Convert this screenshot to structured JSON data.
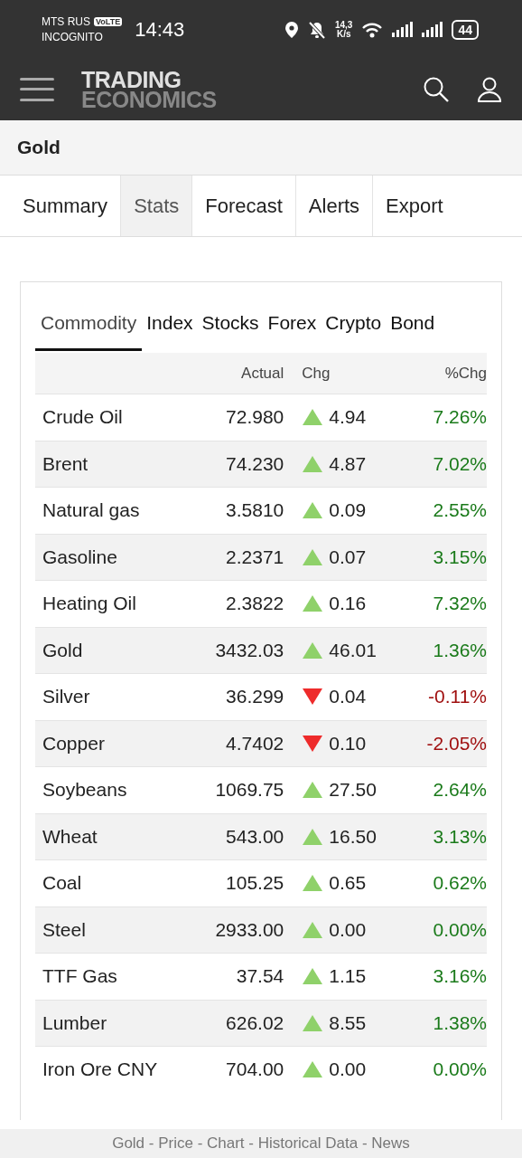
{
  "status_bar": {
    "carrier": "MTS RUS",
    "volte": "VoLTE",
    "mode": "INCOGNITO",
    "time": "14:43",
    "speed_value": "14,3",
    "speed_unit": "K/s",
    "battery": "44"
  },
  "header": {
    "logo_top": "TRADING",
    "logo_bottom": "ECONOMICS"
  },
  "page_title": "Gold",
  "tabs": [
    {
      "label": "Summary",
      "selected": false
    },
    {
      "label": "Stats",
      "selected": true
    },
    {
      "label": "Forecast",
      "selected": false
    },
    {
      "label": "Alerts",
      "selected": false
    },
    {
      "label": "Export",
      "selected": false
    }
  ],
  "market_tabs": [
    {
      "label": "Commodity",
      "selected": true
    },
    {
      "label": "Index",
      "selected": false
    },
    {
      "label": "Stocks",
      "selected": false
    },
    {
      "label": "Forex",
      "selected": false
    },
    {
      "label": "Crypto",
      "selected": false
    },
    {
      "label": "Bond",
      "selected": false
    }
  ],
  "table": {
    "columns": [
      "Actual",
      "Chg",
      "%Chg"
    ],
    "rows": [
      {
        "name": "Crude Oil",
        "actual": "72.980",
        "up": true,
        "chg": "4.94",
        "pct": "7.26%"
      },
      {
        "name": "Brent",
        "actual": "74.230",
        "up": true,
        "chg": "4.87",
        "pct": "7.02%"
      },
      {
        "name": "Natural gas",
        "actual": "3.5810",
        "up": true,
        "chg": "0.09",
        "pct": "2.55%"
      },
      {
        "name": "Gasoline",
        "actual": "2.2371",
        "up": true,
        "chg": "0.07",
        "pct": "3.15%"
      },
      {
        "name": "Heating Oil",
        "actual": "2.3822",
        "up": true,
        "chg": "0.16",
        "pct": "7.32%"
      },
      {
        "name": "Gold",
        "actual": "3432.03",
        "up": true,
        "chg": "46.01",
        "pct": "1.36%"
      },
      {
        "name": "Silver",
        "actual": "36.299",
        "up": false,
        "chg": "0.04",
        "pct": "-0.11%"
      },
      {
        "name": "Copper",
        "actual": "4.7402",
        "up": false,
        "chg": "0.10",
        "pct": "-2.05%"
      },
      {
        "name": "Soybeans",
        "actual": "1069.75",
        "up": true,
        "chg": "27.50",
        "pct": "2.64%"
      },
      {
        "name": "Wheat",
        "actual": "543.00",
        "up": true,
        "chg": "16.50",
        "pct": "3.13%"
      },
      {
        "name": "Coal",
        "actual": "105.25",
        "up": true,
        "chg": "0.65",
        "pct": "0.62%"
      },
      {
        "name": "Steel",
        "actual": "2933.00",
        "up": true,
        "chg": "0.00",
        "pct": "0.00%"
      },
      {
        "name": "TTF Gas",
        "actual": "37.54",
        "up": true,
        "chg": "1.15",
        "pct": "3.16%"
      },
      {
        "name": "Lumber",
        "actual": "626.02",
        "up": true,
        "chg": "8.55",
        "pct": "1.38%"
      },
      {
        "name": "Iron Ore CNY",
        "actual": "704.00",
        "up": true,
        "chg": "0.00",
        "pct": "0.00%"
      }
    ]
  },
  "footer": "Gold - Price - Chart - Historical Data - News"
}
